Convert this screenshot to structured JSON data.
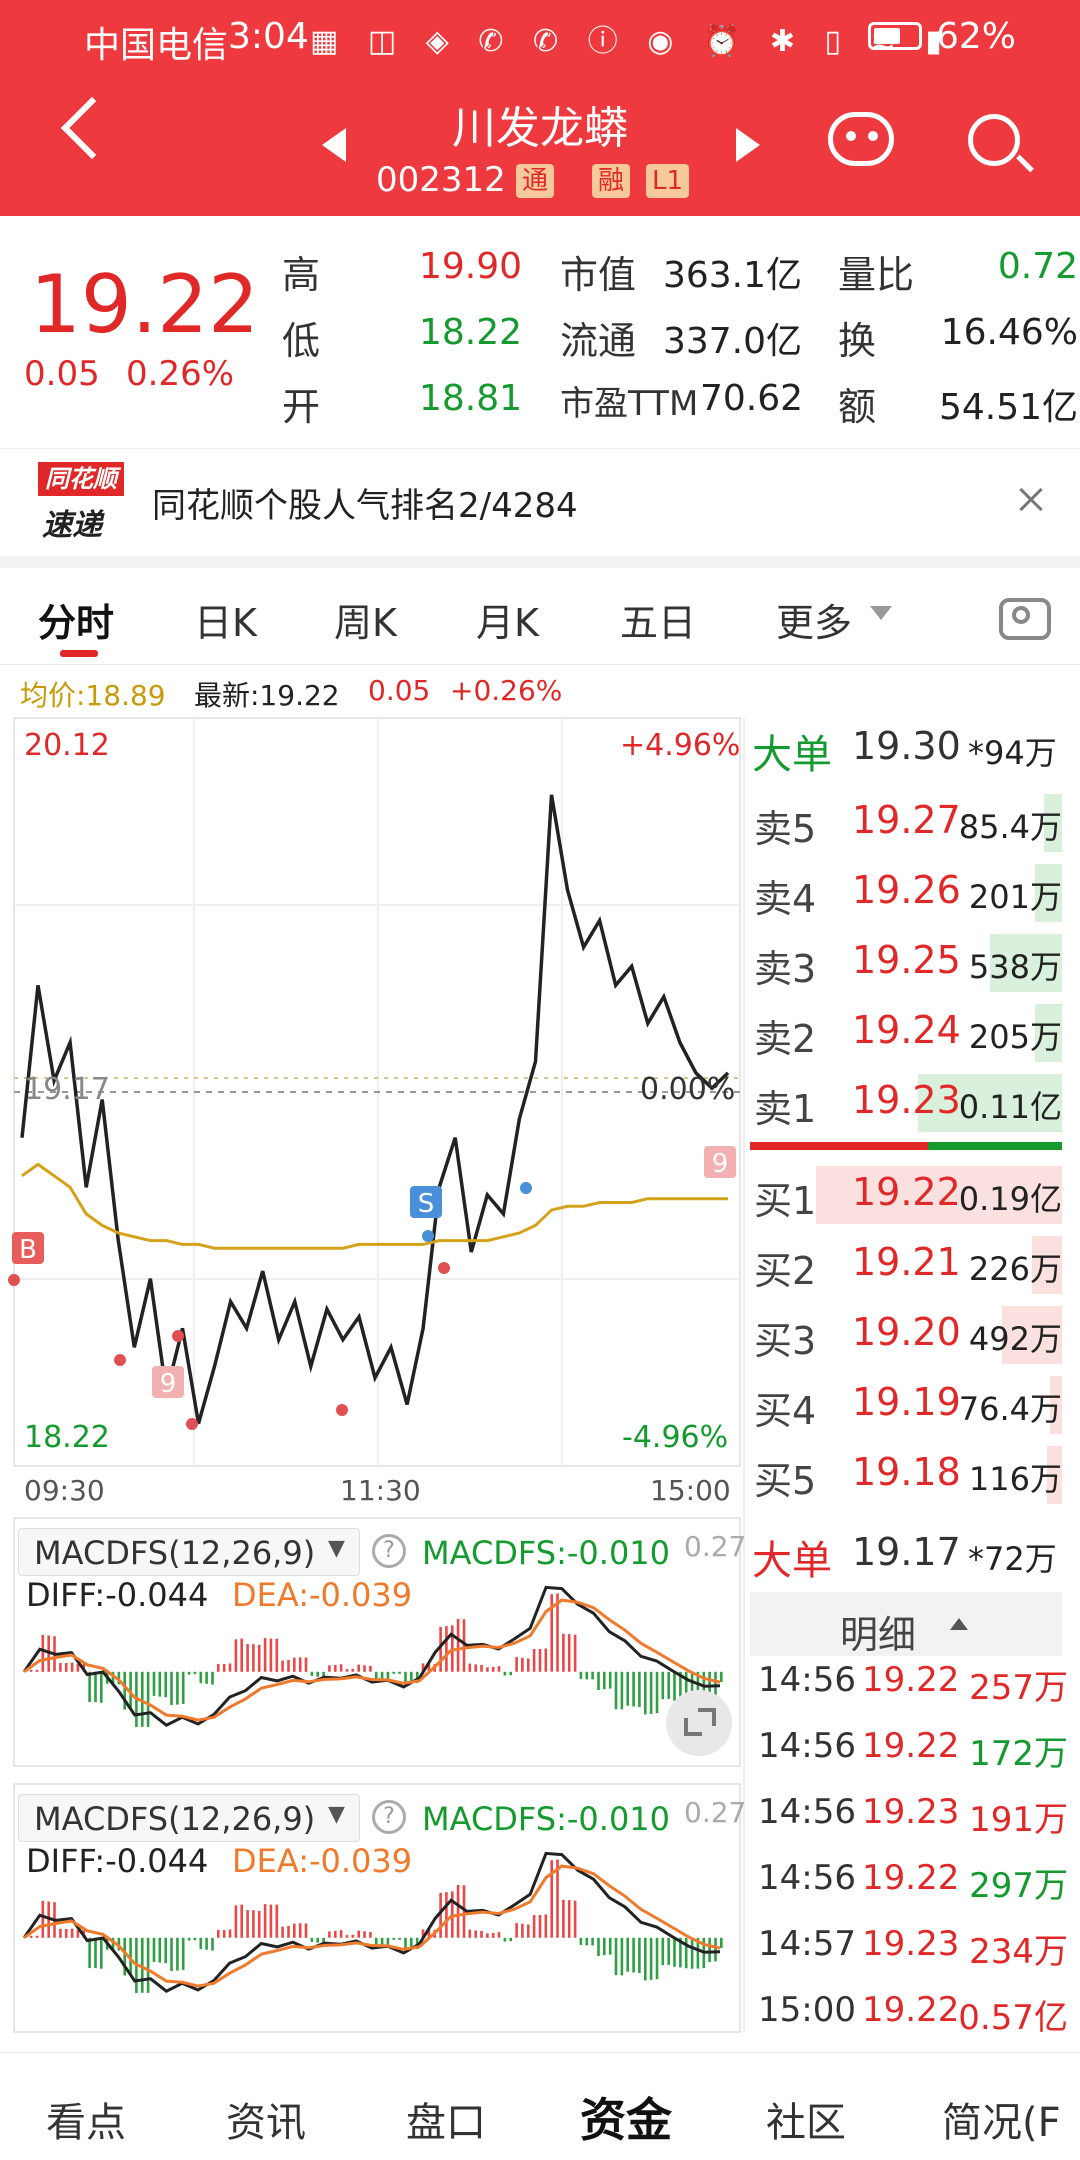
{
  "status": {
    "carrier": "中国电信",
    "time": "3:04",
    "battery": "62%",
    "icons": "▦ ◫ ◈ ✆ ✆ ⓘ ◉ ⏰ ✱ ▯ ≋ ▮"
  },
  "header": {
    "name": "川发龙蟒",
    "code": "002312",
    "tags": [
      "通",
      "融",
      "L1"
    ]
  },
  "quote": {
    "price": "19.22",
    "change": "0.05",
    "change_pct": "0.26%",
    "high_label": "高",
    "high": "19.90",
    "low_label": "低",
    "low": "18.22",
    "open_label": "开",
    "open": "18.81",
    "mcap_label": "市值",
    "mcap": "363.1亿",
    "float_label": "流通",
    "float": "337.0亿",
    "pe_label": "市盈TTM",
    "pe": "70.62",
    "vol_ratio_label": "量比",
    "vol_ratio": "0.72",
    "turnover_label": "换",
    "turnover": "16.46%",
    "amount_label": "额",
    "amount": "54.51亿"
  },
  "banner": {
    "logo_top": "同花顺",
    "logo_bottom": "速递",
    "text": "同花顺个股人气排名2/4284"
  },
  "tabs": [
    "分时",
    "日K",
    "周K",
    "月K",
    "五日",
    "更多"
  ],
  "info": {
    "avg_label": "均价:18.89",
    "latest_label": "最新:19.22",
    "chg": "0.05",
    "pct": "+0.26%"
  },
  "chart": {
    "price_high": "20.12",
    "price_low": "18.22",
    "pct_high": "+4.96%",
    "pct_low": "-4.96%",
    "prev_close": "19.17",
    "zero_pct": "0.00%",
    "times": [
      "09:30",
      "11:30",
      "15:00"
    ],
    "markers": [
      "B",
      "S",
      "9",
      "9"
    ]
  },
  "chart_data": {
    "type": "line",
    "title": "",
    "xlabel": "",
    "ylabel": "",
    "ylim": [
      18.22,
      20.12
    ],
    "x_ticks": [
      "09:30",
      "11:30",
      "15:00"
    ],
    "series": [
      {
        "name": "",
        "values": [
          19.05,
          19.45,
          19.2,
          19.3,
          18.92,
          19.15,
          18.78,
          18.5,
          18.68,
          18.38,
          18.55,
          18.3,
          18.45,
          18.62,
          18.55,
          18.7,
          18.52,
          18.62,
          18.45,
          18.6,
          18.52,
          18.58,
          18.42,
          18.5,
          18.35,
          18.55,
          18.92,
          19.05,
          18.75,
          18.9,
          18.85,
          19.1,
          19.25,
          19.95,
          19.7,
          19.55,
          19.62,
          19.45,
          19.5,
          19.35,
          19.42,
          19.3,
          19.22,
          19.18,
          19.22
        ]
      },
      {
        "name": "均价",
        "values": [
          18.95,
          18.98,
          18.95,
          18.92,
          18.85,
          18.82,
          18.8,
          18.79,
          18.78,
          18.78,
          18.77,
          18.77,
          18.76,
          18.76,
          18.76,
          18.76,
          18.76,
          18.76,
          18.76,
          18.76,
          18.76,
          18.77,
          18.77,
          18.77,
          18.77,
          18.77,
          18.78,
          18.78,
          18.78,
          18.78,
          18.79,
          18.8,
          18.82,
          18.86,
          18.87,
          18.87,
          18.88,
          18.88,
          18.88,
          18.89,
          18.89,
          18.89,
          18.89,
          18.89,
          18.89
        ]
      }
    ]
  },
  "orderbook": {
    "big_top": {
      "label": "大单",
      "price": "19.30",
      "vol": "*94万"
    },
    "asks": [
      {
        "label": "卖5",
        "price": "19.27",
        "vol": "85.4万",
        "depth": 0.06
      },
      {
        "label": "卖4",
        "price": "19.26",
        "vol": "201万",
        "depth": 0.09
      },
      {
        "label": "卖3",
        "price": "19.25",
        "vol": "538万",
        "depth": 0.24
      },
      {
        "label": "卖2",
        "price": "19.24",
        "vol": "205万",
        "depth": 0.09
      },
      {
        "label": "卖1",
        "price": "19.23",
        "vol": "0.11亿",
        "depth": 0.48
      }
    ],
    "bids": [
      {
        "label": "买1",
        "price": "19.22",
        "vol": "0.19亿",
        "depth": 0.82
      },
      {
        "label": "买2",
        "price": "19.21",
        "vol": "226万",
        "depth": 0.1
      },
      {
        "label": "买3",
        "price": "19.20",
        "vol": "492万",
        "depth": 0.2
      },
      {
        "label": "买4",
        "price": "19.19",
        "vol": "76.4万",
        "depth": 0.04
      },
      {
        "label": "买5",
        "price": "19.18",
        "vol": "116万",
        "depth": 0.05
      }
    ],
    "big_bottom": {
      "label": "大单",
      "price": "19.17",
      "vol": "*72万"
    }
  },
  "detail": {
    "label": "明细",
    "ticks": [
      {
        "time": "14:56",
        "price": "19.22",
        "vol": "257万",
        "pcolor": "#e02828",
        "vcolor": "#e02828"
      },
      {
        "time": "14:56",
        "price": "19.22",
        "vol": "172万",
        "pcolor": "#e02828",
        "vcolor": "#149a2e"
      },
      {
        "time": "14:56",
        "price": "19.23",
        "vol": "191万",
        "pcolor": "#e02828",
        "vcolor": "#e02828"
      },
      {
        "time": "14:56",
        "price": "19.22",
        "vol": "297万",
        "pcolor": "#e02828",
        "vcolor": "#149a2e"
      },
      {
        "time": "14:57",
        "price": "19.23",
        "vol": "234万",
        "pcolor": "#e02828",
        "vcolor": "#e02828"
      },
      {
        "time": "15:00",
        "price": "19.22",
        "vol": "0.57亿",
        "pcolor": "#e02828",
        "vcolor": "#e02828"
      }
    ]
  },
  "macd": {
    "name": "MACDFS(12,26,9)",
    "macdfs": "MACDFS:-0.010",
    "diff": "DIFF:-0.044",
    "dea": "DEA:-0.039",
    "scale": "0.27"
  },
  "bottom_nav": [
    "看点",
    "资讯",
    "盘口",
    "资金",
    "社区",
    "简况(F"
  ]
}
